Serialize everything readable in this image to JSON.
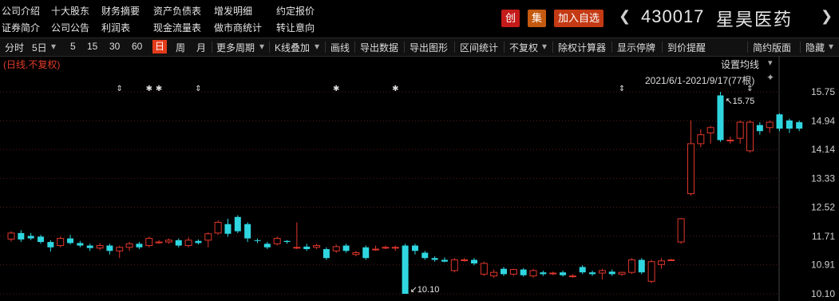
{
  "menu": {
    "row1": [
      "公司介绍",
      "十大股东",
      "财务摘要",
      "资产负债表",
      "增发明细",
      "约定报价"
    ],
    "row2": [
      "证券简介",
      "公司公告",
      "利润表",
      "现金流量表",
      "做市商统计",
      "转让意向"
    ]
  },
  "badges": {
    "chuang": "创",
    "ji": "集",
    "add_watch": "加入自选"
  },
  "stock": {
    "code": "430017",
    "name": "星昊医药"
  },
  "toolbar": {
    "items": [
      "分时",
      "5日",
      "5",
      "15",
      "30",
      "60",
      "日",
      "周",
      "月",
      "更多周期",
      "K线叠加",
      "画线",
      "导出数据",
      "导出图形",
      "区间统计",
      "不复权",
      "除权计算器",
      "显示停牌",
      "到价提醒",
      "简约版面",
      "隐藏"
    ],
    "active": "日"
  },
  "sub_label": "(日线,不复权)",
  "set_ma": "设置均线",
  "range": "2021/6/1-2021/9/17(77根)",
  "colors": {
    "up": "#e0362c",
    "down": "#2fd6e0",
    "grid": "#5a1a1a",
    "bg": "#000000"
  },
  "chart_data": {
    "type": "candlestick",
    "y_ticks": [
      "15.75",
      "14.94",
      "14.14",
      "13.33",
      "12.52",
      "11.71",
      "10.91",
      "10.10"
    ],
    "annotations": {
      "high": "15.75",
      "low": "10.10"
    },
    "candles": [
      [
        11.63,
        11.8,
        11.85,
        11.56
      ],
      [
        11.8,
        11.62,
        11.88,
        11.55
      ],
      [
        11.72,
        11.65,
        11.8,
        11.6
      ],
      [
        11.7,
        11.55,
        11.75,
        11.5
      ],
      [
        11.55,
        11.4,
        11.6,
        11.28
      ],
      [
        11.45,
        11.65,
        11.7,
        11.4
      ],
      [
        11.65,
        11.52,
        11.75,
        11.48
      ],
      [
        11.52,
        11.45,
        11.58,
        11.4
      ],
      [
        11.45,
        11.38,
        11.5,
        11.3
      ],
      [
        11.38,
        11.45,
        11.52,
        11.32
      ],
      [
        11.45,
        11.3,
        11.5,
        11.2
      ],
      [
        11.3,
        11.4,
        11.45,
        11.1
      ],
      [
        11.4,
        11.5,
        11.55,
        11.3
      ],
      [
        11.5,
        11.4,
        11.55,
        11.35
      ],
      [
        11.45,
        11.65,
        11.7,
        11.4
      ],
      [
        11.55,
        11.55,
        11.6,
        11.5
      ],
      [
        11.55,
        11.6,
        11.65,
        11.5
      ],
      [
        11.6,
        11.45,
        11.65,
        11.4
      ],
      [
        11.45,
        11.6,
        11.68,
        11.4
      ],
      [
        11.58,
        11.52,
        11.62,
        11.48
      ],
      [
        11.6,
        11.78,
        11.82,
        11.4
      ],
      [
        11.8,
        12.1,
        12.15,
        11.75
      ],
      [
        12.05,
        11.78,
        12.2,
        11.7
      ],
      [
        12.25,
        11.85,
        12.3,
        11.8
      ],
      [
        12.05,
        11.65,
        12.1,
        11.55
      ],
      [
        11.6,
        11.58,
        11.65,
        11.52
      ],
      [
        11.5,
        11.4,
        11.55,
        11.35
      ],
      [
        11.5,
        11.65,
        11.7,
        11.45
      ],
      [
        11.58,
        11.55,
        11.6,
        11.5
      ],
      [
        11.4,
        11.4,
        12.1,
        11.35
      ],
      [
        11.42,
        11.35,
        11.5,
        11.3
      ],
      [
        11.4,
        11.45,
        11.5,
        11.35
      ],
      [
        11.35,
        11.1,
        11.4,
        11.05
      ],
      [
        11.3,
        11.42,
        11.48,
        11.25
      ],
      [
        11.45,
        11.3,
        11.5,
        11.25
      ],
      [
        11.2,
        11.25,
        11.3,
        11.15
      ],
      [
        11.4,
        11.1,
        11.45,
        11.05
      ],
      [
        11.35,
        11.35,
        11.45,
        11.3
      ],
      [
        11.4,
        11.4,
        11.45,
        11.35
      ],
      [
        11.4,
        11.4,
        11.45,
        11.3
      ],
      [
        11.45,
        10.1,
        11.5,
        10.1
      ],
      [
        11.45,
        11.3,
        11.5,
        11.2
      ],
      [
        11.25,
        11.1,
        11.3,
        11.05
      ],
      [
        11.1,
        11.05,
        11.15,
        11.0
      ],
      [
        11.05,
        11.0,
        11.12,
        10.98
      ],
      [
        10.75,
        11.05,
        11.1,
        10.7
      ],
      [
        11.05,
        11.05,
        11.1,
        11.0
      ],
      [
        11.05,
        10.95,
        11.1,
        10.9
      ],
      [
        10.65,
        10.95,
        11.0,
        10.6
      ],
      [
        10.6,
        10.7,
        10.78,
        10.55
      ],
      [
        10.8,
        10.65,
        10.85,
        10.6
      ],
      [
        10.65,
        10.78,
        10.8,
        10.6
      ],
      [
        10.78,
        10.62,
        10.82,
        10.58
      ],
      [
        10.6,
        10.75,
        10.8,
        10.55
      ],
      [
        10.7,
        10.65,
        10.75,
        10.6
      ],
      [
        10.68,
        10.68,
        10.72,
        10.62
      ],
      [
        10.7,
        10.62,
        10.75,
        10.58
      ],
      [
        10.6,
        10.6,
        10.65,
        10.55
      ],
      [
        10.85,
        10.7,
        10.9,
        10.65
      ],
      [
        10.7,
        10.65,
        10.75,
        10.6
      ],
      [
        10.68,
        10.75,
        10.8,
        10.5
      ],
      [
        10.72,
        10.65,
        10.78,
        10.6
      ],
      [
        10.65,
        10.7,
        10.72,
        10.6
      ],
      [
        10.7,
        11.05,
        11.1,
        10.65
      ],
      [
        11.05,
        10.7,
        11.1,
        10.65
      ],
      [
        10.45,
        11.0,
        11.05,
        10.4
      ],
      [
        10.92,
        11.02,
        11.1,
        10.8
      ],
      [
        11.05,
        11.05,
        11.08,
        11.02
      ],
      [
        11.55,
        12.2,
        12.22,
        11.5
      ],
      [
        12.9,
        14.3,
        14.95,
        12.85
      ],
      [
        14.3,
        14.55,
        14.7,
        14.2
      ],
      [
        14.6,
        14.75,
        14.8,
        14.3
      ],
      [
        15.65,
        14.4,
        15.75,
        14.35
      ],
      [
        14.4,
        14.4,
        14.5,
        14.3
      ],
      [
        14.45,
        14.9,
        14.95,
        14.3
      ],
      [
        14.1,
        14.9,
        14.95,
        14.05
      ],
      [
        14.82,
        14.65,
        14.9,
        14.55
      ],
      [
        14.75,
        14.9,
        14.95,
        14.6
      ],
      [
        15.12,
        14.72,
        15.15,
        14.65
      ],
      [
        14.95,
        14.72,
        15.0,
        14.6
      ],
      [
        14.9,
        14.72,
        14.95,
        14.65
      ]
    ]
  }
}
